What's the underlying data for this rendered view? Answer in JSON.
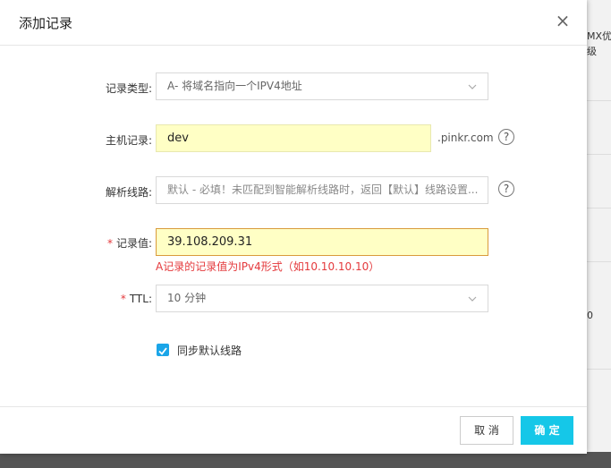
{
  "background": {
    "text_line1": "MX优",
    "text_line2": "级",
    "text_line3": "0"
  },
  "dialog": {
    "title": "添加记录",
    "close_glyph": "×"
  },
  "form": {
    "record_type": {
      "label": "记录类型:",
      "value": "A- 将域名指向一个IPV4地址"
    },
    "host": {
      "label": "主机记录:",
      "value": "dev",
      "suffix": ".pinkr.com",
      "help": "?"
    },
    "line": {
      "label": "解析线路:",
      "value": "默认 - 必填！未匹配到智能解析线路时，返回【默认】线路设置...",
      "help": "?"
    },
    "record_value": {
      "required_mark": "*",
      "label": "记录值:",
      "value": "39.108.209.31",
      "error": "A记录的记录值为IPv4形式（如10.10.10.10）"
    },
    "ttl": {
      "required_mark": "*",
      "label": "TTL:",
      "value": "10 分钟"
    },
    "sync_default_line": {
      "label": "同步默认线路",
      "checked": true
    }
  },
  "footer": {
    "cancel_label": "取 消",
    "confirm_label": "确 定"
  },
  "colors": {
    "accent": "#15c7e8",
    "checkbox": "#1aa5e8",
    "error": "#e4393c",
    "highlight_field": "#ffffc5"
  }
}
